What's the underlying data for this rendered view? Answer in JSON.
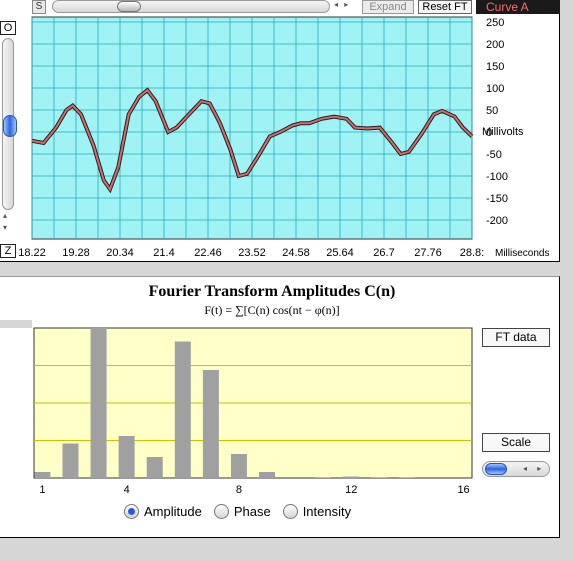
{
  "toolbar": {
    "s_label": "S",
    "expand_label": "Expand",
    "reset_ft_label": "Reset FT",
    "curve_label": "Curve A",
    "h_arrows": "◂ ▸"
  },
  "side": {
    "o_label": "O",
    "z_label": "Z",
    "up_arrow": "▴",
    "down_arrow": "▾"
  },
  "colors": {
    "plot_bg": "#9ff3f5",
    "grid": "#2aa8b8",
    "trace": "#d46a6a",
    "bar_bg": "#ffffc8",
    "bar_grid": "#c8c400",
    "bar": "#a0a0a0"
  },
  "waveform": {
    "y_unit": "Millivolts",
    "x_unit": "Milliseconds",
    "y_ticks": [
      "250",
      "200",
      "150",
      "100",
      "50",
      "0",
      "-50",
      "-100",
      "-150",
      "-200"
    ],
    "x_ticks": [
      "18.22",
      "19.28",
      "20.34",
      "21.4",
      "22.46",
      "23.52",
      "24.58",
      "25.64",
      "26.7",
      "27.76",
      "28.8:"
    ],
    "x_range": [
      18.22,
      28.82
    ],
    "y_range": [
      -250,
      250
    ],
    "points": [
      [
        18.22,
        -20
      ],
      [
        18.5,
        -25
      ],
      [
        18.8,
        10
      ],
      [
        19.05,
        50
      ],
      [
        19.2,
        60
      ],
      [
        19.4,
        40
      ],
      [
        19.7,
        -30
      ],
      [
        19.95,
        -110
      ],
      [
        20.1,
        -130
      ],
      [
        20.3,
        -80
      ],
      [
        20.55,
        40
      ],
      [
        20.8,
        80
      ],
      [
        21.0,
        95
      ],
      [
        21.2,
        70
      ],
      [
        21.5,
        0
      ],
      [
        21.7,
        10
      ],
      [
        22.0,
        40
      ],
      [
        22.3,
        70
      ],
      [
        22.5,
        65
      ],
      [
        22.75,
        20
      ],
      [
        23.0,
        -40
      ],
      [
        23.2,
        -100
      ],
      [
        23.4,
        -95
      ],
      [
        23.7,
        -50
      ],
      [
        23.95,
        -10
      ],
      [
        24.2,
        0
      ],
      [
        24.5,
        15
      ],
      [
        24.7,
        20
      ],
      [
        24.9,
        20
      ],
      [
        25.2,
        30
      ],
      [
        25.5,
        35
      ],
      [
        25.8,
        30
      ],
      [
        26.0,
        10
      ],
      [
        26.3,
        8
      ],
      [
        26.6,
        10
      ],
      [
        26.9,
        -25
      ],
      [
        27.1,
        -50
      ],
      [
        27.3,
        -45
      ],
      [
        27.6,
        -5
      ],
      [
        27.9,
        40
      ],
      [
        28.1,
        48
      ],
      [
        28.4,
        35
      ],
      [
        28.6,
        10
      ],
      [
        28.82,
        -10
      ]
    ]
  },
  "ft": {
    "title": "Fourier Transform Amplitudes C(n)",
    "formula": "F(t) = ∑[C(n) cos(nt − φ(n)]",
    "ft_data_label": "FT data",
    "scale_label": "Scale",
    "scale_arrows": "◂ ▸",
    "modes": [
      {
        "label": "Amplitude",
        "selected": true
      },
      {
        "label": "Phase",
        "selected": false
      },
      {
        "label": "Intensity",
        "selected": false
      }
    ]
  },
  "chart_data": {
    "type": "bar",
    "x": [
      1,
      2,
      3,
      4,
      5,
      6,
      7,
      8,
      9,
      10,
      11,
      12,
      13,
      14,
      15
    ],
    "values": [
      4,
      23,
      100,
      28,
      14,
      91,
      72,
      16,
      4,
      0,
      0.5,
      1,
      0.5,
      0.5,
      0
    ],
    "x_ticks": [
      "1",
      "4",
      "8",
      "12",
      "16"
    ],
    "xlim": [
      0.7,
      16.3
    ],
    "ylim": [
      0,
      100
    ],
    "grid": true
  }
}
